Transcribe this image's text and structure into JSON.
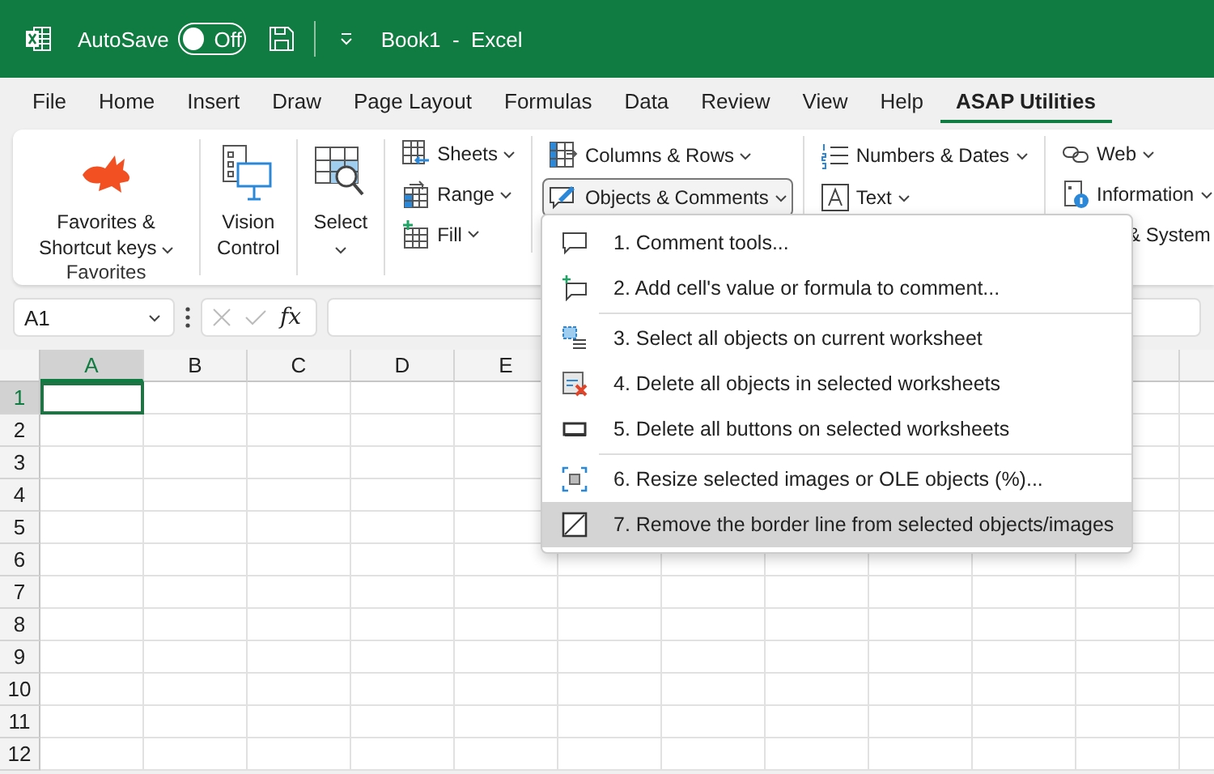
{
  "title_bar": {
    "autosave_label": "AutoSave",
    "autosave": {
      "on": false,
      "label": "Off"
    },
    "title": "Book1  -  Excel"
  },
  "tabs": [
    {
      "label": "File",
      "selected": false
    },
    {
      "label": "Home",
      "selected": false
    },
    {
      "label": "Insert",
      "selected": false
    },
    {
      "label": "Draw",
      "selected": false
    },
    {
      "label": "Page Layout",
      "selected": false
    },
    {
      "label": "Formulas",
      "selected": false
    },
    {
      "label": "Data",
      "selected": false
    },
    {
      "label": "Review",
      "selected": false
    },
    {
      "label": "View",
      "selected": false
    },
    {
      "label": "Help",
      "selected": false
    },
    {
      "label": "ASAP Utilities",
      "selected": true
    }
  ],
  "ribbon": {
    "large_buttons": [
      {
        "lines": [
          "Favorites &",
          "Shortcut keys"
        ],
        "dropdown": true,
        "group_label": "Favorites"
      },
      {
        "lines": [
          "Vision",
          "Control"
        ],
        "dropdown": false
      },
      {
        "lines": [
          "Select"
        ],
        "dropdown": true
      }
    ],
    "small_columns": [
      [
        {
          "label": "Sheets",
          "dropdown": true,
          "open": false
        },
        {
          "label": "Range",
          "dropdown": true,
          "open": false
        },
        {
          "label": "Fill",
          "dropdown": true,
          "open": false
        }
      ],
      [
        {
          "label": "Columns & Rows",
          "dropdown": true,
          "open": false
        },
        {
          "label": "Objects & Comments",
          "dropdown": true,
          "open": true
        }
      ],
      [
        {
          "label": "Numbers & Dates",
          "dropdown": true,
          "open": false
        },
        {
          "label": "Text",
          "dropdown": true,
          "open": false
        }
      ],
      [
        {
          "label": "Web",
          "dropdown": true,
          "open": false
        },
        {
          "label": "Information",
          "dropdown": true,
          "open": false
        },
        {
          "label": "& System",
          "dropdown": false,
          "open": false
        }
      ]
    ]
  },
  "formula_bar": {
    "name_box": "A1",
    "fx": "fx"
  },
  "sheet": {
    "columns": [
      {
        "label": "A",
        "selected": true
      },
      {
        "label": "B",
        "selected": false
      },
      {
        "label": "C",
        "selected": false
      },
      {
        "label": "D",
        "selected": false
      },
      {
        "label": "E",
        "selected": false
      }
    ],
    "rows": [
      {
        "label": "1",
        "selected": true
      },
      {
        "label": "2",
        "selected": false
      },
      {
        "label": "3",
        "selected": false
      },
      {
        "label": "4",
        "selected": false
      },
      {
        "label": "5",
        "selected": false
      },
      {
        "label": "6",
        "selected": false
      },
      {
        "label": "7",
        "selected": false
      },
      {
        "label": "8",
        "selected": false
      },
      {
        "label": "9",
        "selected": false
      },
      {
        "label": "10",
        "selected": false
      },
      {
        "label": "11",
        "selected": false
      },
      {
        "label": "12",
        "selected": false
      }
    ]
  },
  "menu": {
    "items": [
      {
        "label": "1. Comment tools...",
        "separator_before": false,
        "selected": false
      },
      {
        "label": "2. Add cell's value or formula to comment...",
        "separator_before": false,
        "selected": false
      },
      {
        "label": "3. Select all objects on current worksheet",
        "separator_before": true,
        "selected": false
      },
      {
        "label": "4. Delete all objects in selected worksheets",
        "separator_before": false,
        "selected": false
      },
      {
        "label": "5. Delete all buttons on selected worksheets",
        "separator_before": false,
        "selected": false
      },
      {
        "label": "6. Resize selected images or OLE objects (%)...",
        "separator_before": true,
        "selected": false
      },
      {
        "label": "7. Remove the border line from selected objects/images",
        "separator_before": false,
        "selected": true
      }
    ]
  }
}
